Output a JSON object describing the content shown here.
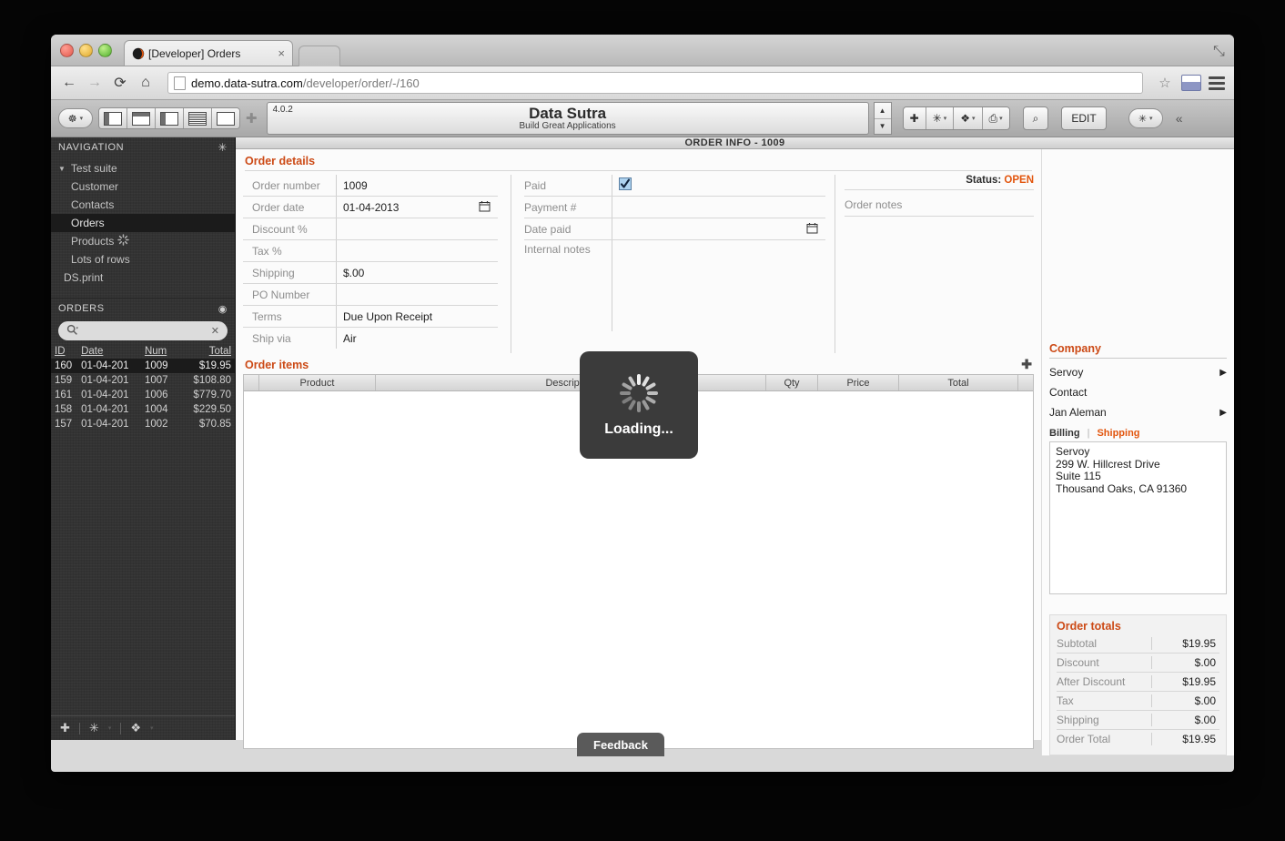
{
  "browser": {
    "tab_title": "[Developer] Orders",
    "tab_close": "×",
    "url_host": "demo.data-sutra.com",
    "url_path": "/developer/order/-/160",
    "back_icon": "←",
    "forward_icon": "→",
    "reload_icon": "⟳",
    "home_icon": "⌂",
    "star_icon": "☆",
    "expand_icon": "⤡"
  },
  "apptoolbar": {
    "version": "4.0.2",
    "app_name": "Data Sutra",
    "app_tagline": "Build Great Applications",
    "spin_up": "▲",
    "spin_down": "▼",
    "plus_label": "✚",
    "sun_label": "✳",
    "diamond_label": "❖",
    "print_label": "⎙",
    "search_label": "⌕",
    "edit_label": "EDIT",
    "collapse_label": "«",
    "compass_label": "☸",
    "add_panel_label": "✚"
  },
  "sidebar": {
    "nav_header": "NAVIGATION",
    "nav_gear": "✳",
    "nav_items": [
      {
        "label": "Test suite",
        "level": 0,
        "expander": "▼",
        "selected": false
      },
      {
        "label": "Customer",
        "level": 1,
        "selected": false
      },
      {
        "label": "Contacts",
        "level": 1,
        "selected": false
      },
      {
        "label": "Orders",
        "level": 1,
        "selected": true
      },
      {
        "label": "Products",
        "level": 1,
        "selected": false,
        "busy": true
      },
      {
        "label": "Lots of rows",
        "level": 1,
        "selected": false
      },
      {
        "label": "DS.print",
        "level": 0,
        "selected": false
      }
    ],
    "orders_header": "ORDERS",
    "orders_gear": "◉",
    "search_icon": "⚲",
    "search_caret": "▾",
    "search_value": "",
    "search_clear": "✕",
    "columns": [
      "ID",
      "Date",
      "Num",
      "Total"
    ],
    "sort_indicator": "▴",
    "rows": [
      {
        "id": "160",
        "date": "01-04-201",
        "num": "1009",
        "total": "$19.95",
        "selected": true
      },
      {
        "id": "159",
        "date": "01-04-201",
        "num": "1007",
        "total": "$108.80",
        "selected": false
      },
      {
        "id": "161",
        "date": "01-04-201",
        "num": "1006",
        "total": "$779.70",
        "selected": false
      },
      {
        "id": "158",
        "date": "01-04-201",
        "num": "1004",
        "total": "$229.50",
        "selected": false
      },
      {
        "id": "157",
        "date": "01-04-201",
        "num": "1002",
        "total": "$70.85",
        "selected": false
      }
    ],
    "foot_plus": "✚",
    "foot_gear": "✳",
    "foot_diamond": "❖"
  },
  "main": {
    "title": "ORDER INFO - 1009",
    "section_order_details": "Order details",
    "status_label": "Status:",
    "status_value": "OPEN",
    "fields_left": [
      {
        "label": "Order number",
        "value": "1009"
      },
      {
        "label": "Order date",
        "value": "01-04-2013",
        "calendar": true
      },
      {
        "label": "Discount %",
        "value": ""
      },
      {
        "label": "Tax %",
        "value": ""
      },
      {
        "label": "Shipping",
        "value": "$.00"
      },
      {
        "label": "PO Number",
        "value": ""
      },
      {
        "label": "Terms",
        "value": "Due Upon Receipt"
      },
      {
        "label": "Ship via",
        "value": "Air"
      }
    ],
    "fields_mid": [
      {
        "label": "Paid",
        "value": "",
        "checkbox": true,
        "checked": true
      },
      {
        "label": "Payment #",
        "value": ""
      },
      {
        "label": "Date paid",
        "value": "",
        "calendar": true
      }
    ],
    "internal_notes_label": "Internal notes",
    "internal_notes_value": "",
    "order_notes_label": "Order notes",
    "order_notes_value": "",
    "section_order_items": "Order items",
    "items_add": "✚",
    "items_columns": [
      "",
      "Product",
      "Description",
      "Qty",
      "Price",
      "Total",
      ""
    ],
    "items_rows": []
  },
  "rail": {
    "company_title": "Company",
    "company_name": "Servoy",
    "contact_label": "Contact",
    "contact_name": "Jan Aleman",
    "arrow": "▶",
    "tab_billing": "Billing",
    "tab_sep": "|",
    "tab_shipping": "Shipping",
    "address_lines": [
      "Servoy",
      "299 W. Hillcrest Drive",
      "Suite 115",
      "Thousand Oaks, CA 91360"
    ],
    "totals_title": "Order totals",
    "totals": [
      {
        "label": "Subtotal",
        "value": "$19.95"
      },
      {
        "label": "Discount",
        "value": "$.00"
      },
      {
        "label": "After Discount",
        "value": "$19.95"
      },
      {
        "label": "Tax",
        "value": "$.00"
      },
      {
        "label": "Shipping",
        "value": "$.00"
      },
      {
        "label": "Order Total",
        "value": "$19.95"
      }
    ]
  },
  "overlays": {
    "loading_text": "Loading...",
    "feedback_text": "Feedback"
  },
  "colors": {
    "accent_orange": "#cc4a16",
    "status_open": "#e2550d",
    "sidebar_bg": "#333333"
  }
}
